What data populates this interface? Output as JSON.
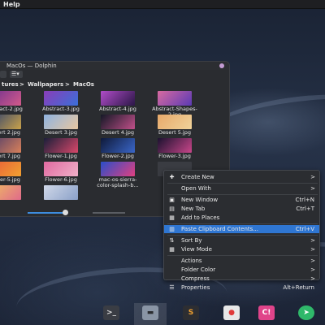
{
  "topbar": {
    "menu_label": "Help"
  },
  "window": {
    "title": "MacOs — Dolphin",
    "breadcrumb": [
      "tures",
      "Wallpapers",
      "MacOs"
    ],
    "files": [
      {
        "name": "Abstract-2.jpg",
        "name2": "",
        "colors": [
          "#6a2f8f",
          "#d35a8a"
        ]
      },
      {
        "name": "Abstract-3.jpg",
        "name2": "",
        "colors": [
          "#8a3db8",
          "#3a6fd8"
        ]
      },
      {
        "name": "Abstract-4.jpg",
        "name2": "",
        "colors": [
          "#b04cc8",
          "#2b1747"
        ]
      },
      {
        "name": "Abstract-Shapes-",
        "name2": "2.jpg",
        "colors": [
          "#d86aa0",
          "#5b3ab4"
        ]
      },
      {
        "name": "Desert 2.jpg",
        "name2": "",
        "colors": [
          "#2a3d6e",
          "#c9a24a"
        ]
      },
      {
        "name": "Desert 3.jpg",
        "name2": "",
        "colors": [
          "#8fb3e0",
          "#e8c7a0"
        ]
      },
      {
        "name": "Desert 4.jpg",
        "name2": "",
        "colors": [
          "#141826",
          "#c0508a"
        ]
      },
      {
        "name": "Desert 5.jpg",
        "name2": "",
        "colors": [
          "#e7a86a",
          "#f0d39a"
        ]
      },
      {
        "name": "Desert 7.jpg",
        "name2": "",
        "colors": [
          "#4a3b6a",
          "#d8805a"
        ]
      },
      {
        "name": "Flower-1.jpg",
        "name2": "",
        "colors": [
          "#1b1f3a",
          "#d8486a"
        ]
      },
      {
        "name": "Flower-2.jpg",
        "name2": "",
        "colors": [
          "#0f1a3a",
          "#3a66c8"
        ]
      },
      {
        "name": "Flower-3.jpg",
        "name2": "",
        "colors": [
          "#1c1230",
          "#c8468a"
        ]
      },
      {
        "name": "Flower-5.jpg",
        "name2": "",
        "colors": [
          "#e8583a",
          "#f0a030"
        ]
      },
      {
        "name": "Flower-6.jpg",
        "name2": "",
        "colors": [
          "#e06aa0",
          "#f0b0c8"
        ]
      },
      {
        "name": "mac-os-sierra-",
        "name2": "color-splash-b...",
        "colors": [
          "#2a4ec8",
          "#e04080"
        ]
      },
      {
        "name": "",
        "name2": "",
        "colors": [
          "#3a3c42",
          "#3a3c42"
        ]
      },
      {
        "name": "",
        "name2": "",
        "colors": [
          "#f0c060",
          "#e06a8a"
        ]
      },
      {
        "name": "",
        "name2": "",
        "colors": [
          "#d0d8e8",
          "#8aa0c8"
        ]
      }
    ],
    "zoom_level": 0.38
  },
  "context_menu": {
    "items": [
      {
        "icon": "new-icon",
        "glyph": "✚",
        "label": "Create New",
        "shortcut": "",
        "submenu": true,
        "sep_before": false,
        "highlighted": false
      },
      {
        "icon": "",
        "glyph": "",
        "label": "Open With",
        "shortcut": "",
        "submenu": true,
        "sep_before": true,
        "highlighted": false
      },
      {
        "icon": "window-icon",
        "glyph": "▣",
        "label": "New Window",
        "shortcut": "Ctrl+N",
        "submenu": false,
        "sep_before": true,
        "highlighted": false
      },
      {
        "icon": "tab-icon",
        "glyph": "▤",
        "label": "New Tab",
        "shortcut": "Ctrl+T",
        "submenu": false,
        "sep_before": false,
        "highlighted": false
      },
      {
        "icon": "places-icon",
        "glyph": "▦",
        "label": "Add to Places",
        "shortcut": "",
        "submenu": false,
        "sep_before": false,
        "highlighted": false
      },
      {
        "icon": "paste-icon",
        "glyph": "▥",
        "label": "Paste Clipboard Contents...",
        "shortcut": "Ctrl+V",
        "submenu": false,
        "sep_before": true,
        "highlighted": true
      },
      {
        "icon": "sort-icon",
        "glyph": "⇅",
        "label": "Sort By",
        "shortcut": "",
        "submenu": true,
        "sep_before": true,
        "highlighted": false
      },
      {
        "icon": "view-icon",
        "glyph": "▦",
        "label": "View Mode",
        "shortcut": "",
        "submenu": true,
        "sep_before": false,
        "highlighted": false
      },
      {
        "icon": "",
        "glyph": "",
        "label": "Actions",
        "shortcut": "",
        "submenu": true,
        "sep_before": true,
        "highlighted": false
      },
      {
        "icon": "",
        "glyph": "",
        "label": "Folder Color",
        "shortcut": "",
        "submenu": true,
        "sep_before": false,
        "highlighted": false
      },
      {
        "icon": "",
        "glyph": "",
        "label": "Compress",
        "shortcut": "",
        "submenu": true,
        "sep_before": false,
        "highlighted": false
      },
      {
        "icon": "properties-icon",
        "glyph": "☰",
        "label": "Properties",
        "shortcut": "Alt+Return",
        "submenu": false,
        "sep_before": false,
        "highlighted": false
      }
    ],
    "submenu_arrow": ">"
  },
  "dock": {
    "items": [
      {
        "name": "terminal-icon",
        "color": "#3a3d44",
        "glyph": ">_",
        "text_color": "#dddddd"
      },
      {
        "name": "file-manager-icon",
        "color": "#8a95a5",
        "glyph": "▬",
        "text_color": "#2a2c30"
      },
      {
        "name": "sublime-text-icon",
        "color": "#2d2e32",
        "glyph": "S",
        "text_color": "#f0a030"
      },
      {
        "name": "text-editor-icon",
        "color": "#e8e8e8",
        "glyph": "●",
        "text_color": "#e03a3a"
      },
      {
        "name": "app-launcher-icon",
        "color": "#e0448a",
        "glyph": "C!",
        "text_color": "#ffffff"
      },
      {
        "name": "telegram-icon",
        "color": "#2fb86a",
        "glyph": "➤",
        "text_color": "#ffffff"
      }
    ]
  }
}
